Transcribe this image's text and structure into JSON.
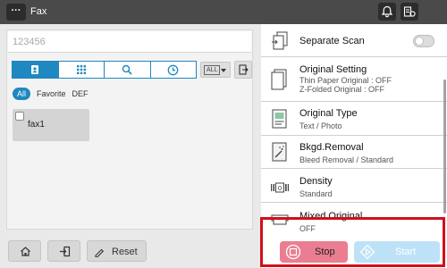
{
  "header": {
    "menu_label": "···",
    "title": "Fax",
    "icons": [
      "bell-icon",
      "device-status-icon"
    ]
  },
  "destination": {
    "placeholder": "123456"
  },
  "toolbar": {
    "tabs": [
      "address-book-icon",
      "keypad-icon",
      "search-icon",
      "history-icon"
    ],
    "active_tab": 0,
    "dropdown_label": "ALL"
  },
  "filters": {
    "items": [
      "All",
      "Favorite",
      "DEF"
    ],
    "selected": "All"
  },
  "destinations": [
    {
      "name": "fax1",
      "checked": false
    }
  ],
  "settings": [
    {
      "title": "Separate Scan",
      "details": [],
      "toggle": "off"
    },
    {
      "title": "Original Setting",
      "details": [
        "Thin Paper Original : OFF",
        "Z-Folded Original : OFF"
      ]
    },
    {
      "title": "Original Type",
      "details": [
        "Text / Photo"
      ]
    },
    {
      "title": "Bkgd.Removal",
      "details": [
        "Bleed Removal / Standard"
      ]
    },
    {
      "title": "Density",
      "details": [
        "Standard"
      ]
    },
    {
      "title": "Mixed Original",
      "details": [
        "OFF"
      ]
    }
  ],
  "bottom": {
    "reset_label": "Reset",
    "stop_label": "Stop",
    "start_label": "Start"
  },
  "colors": {
    "accent": "#1e88c0",
    "stop": "#ea7e90",
    "start": "#bde2f7",
    "highlight": "#d0101a"
  }
}
